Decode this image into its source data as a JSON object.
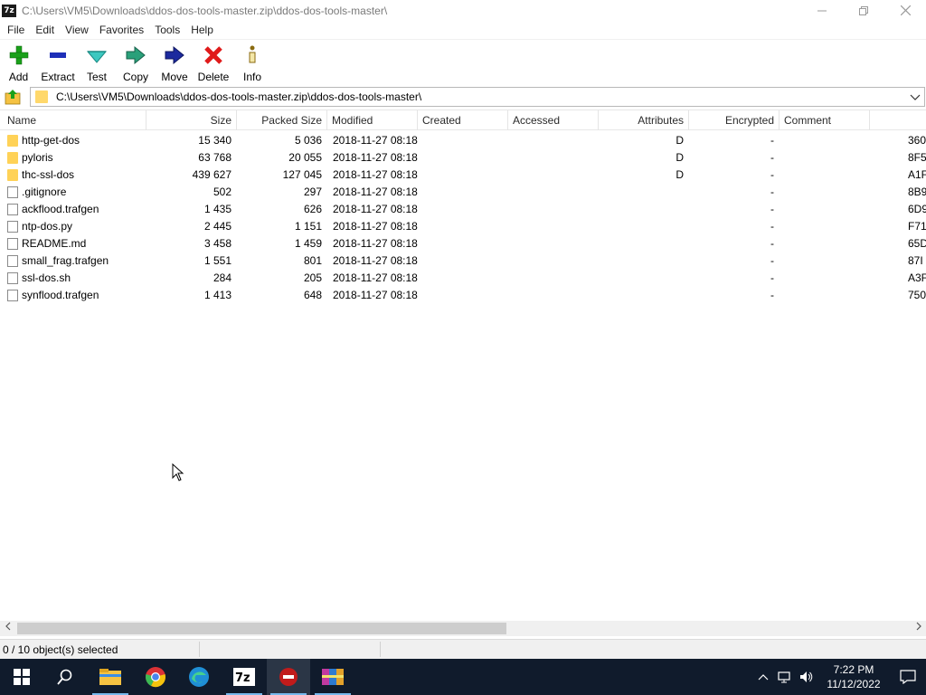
{
  "window": {
    "title": "C:\\Users\\VM5\\Downloads\\ddos-dos-tools-master.zip\\ddos-dos-tools-master\\",
    "app_icon_text": "7z"
  },
  "menu": [
    "File",
    "Edit",
    "View",
    "Favorites",
    "Tools",
    "Help"
  ],
  "toolbar": [
    {
      "label": "Add",
      "icon": "plus-icon"
    },
    {
      "label": "Extract",
      "icon": "minus-icon"
    },
    {
      "label": "Test",
      "icon": "test-check-icon"
    },
    {
      "label": "Copy",
      "icon": "copy-arrow-icon"
    },
    {
      "label": "Move",
      "icon": "move-arrow-icon"
    },
    {
      "label": "Delete",
      "icon": "delete-x-icon"
    },
    {
      "label": "Info",
      "icon": "info-icon"
    }
  ],
  "address": {
    "path": "C:\\Users\\VM5\\Downloads\\ddos-dos-tools-master.zip\\ddos-dos-tools-master\\"
  },
  "columns": [
    "Name",
    "Size",
    "Packed Size",
    "Modified",
    "Created",
    "Accessed",
    "Attributes",
    "Encrypted",
    "Comment"
  ],
  "files": [
    {
      "name": "http-get-dos",
      "type": "folder",
      "size": "15 340",
      "packed": "5 036",
      "modified": "2018-11-27 08:18",
      "attributes": "D",
      "encrypted": "-",
      "crc": "360"
    },
    {
      "name": "pyloris",
      "type": "folder",
      "size": "63 768",
      "packed": "20 055",
      "modified": "2018-11-27 08:18",
      "attributes": "D",
      "encrypted": "-",
      "crc": "8F5"
    },
    {
      "name": "thc-ssl-dos",
      "type": "folder",
      "size": "439 627",
      "packed": "127 045",
      "modified": "2018-11-27 08:18",
      "attributes": "D",
      "encrypted": "-",
      "crc": "A1F"
    },
    {
      "name": ".gitignore",
      "type": "file",
      "size": "502",
      "packed": "297",
      "modified": "2018-11-27 08:18",
      "attributes": "",
      "encrypted": "-",
      "crc": "8B9"
    },
    {
      "name": "ackflood.trafgen",
      "type": "file",
      "size": "1 435",
      "packed": "626",
      "modified": "2018-11-27 08:18",
      "attributes": "",
      "encrypted": "-",
      "crc": "6D9"
    },
    {
      "name": "ntp-dos.py",
      "type": "file",
      "size": "2 445",
      "packed": "1 151",
      "modified": "2018-11-27 08:18",
      "attributes": "",
      "encrypted": "-",
      "crc": "F71"
    },
    {
      "name": "README.md",
      "type": "file",
      "size": "3 458",
      "packed": "1 459",
      "modified": "2018-11-27 08:18",
      "attributes": "",
      "encrypted": "-",
      "crc": "65D"
    },
    {
      "name": "small_frag.trafgen",
      "type": "file",
      "size": "1 551",
      "packed": "801",
      "modified": "2018-11-27 08:18",
      "attributes": "",
      "encrypted": "-",
      "crc": "87I"
    },
    {
      "name": "ssl-dos.sh",
      "type": "file",
      "size": "284",
      "packed": "205",
      "modified": "2018-11-27 08:18",
      "attributes": "",
      "encrypted": "-",
      "crc": "A3F"
    },
    {
      "name": "synflood.trafgen",
      "type": "file",
      "size": "1 413",
      "packed": "648",
      "modified": "2018-11-27 08:18",
      "attributes": "",
      "encrypted": "-",
      "crc": "750"
    }
  ],
  "status": {
    "selection": "0 / 10 object(s) selected"
  },
  "taskbar": {
    "time": "7:22 PM",
    "date": "11/12/2022",
    "apps": [
      "start-icon",
      "search-icon",
      "file-explorer-icon",
      "chrome-icon",
      "edge-icon",
      "7zip-icon",
      "red-app-icon",
      "winrar-icon"
    ]
  },
  "colors": {
    "folder": "#ffd257",
    "taskbar": "#101b2c",
    "add_green": "#1aa01a",
    "delete_red": "#e01b1b",
    "extract_blue": "#1e2fb8"
  }
}
